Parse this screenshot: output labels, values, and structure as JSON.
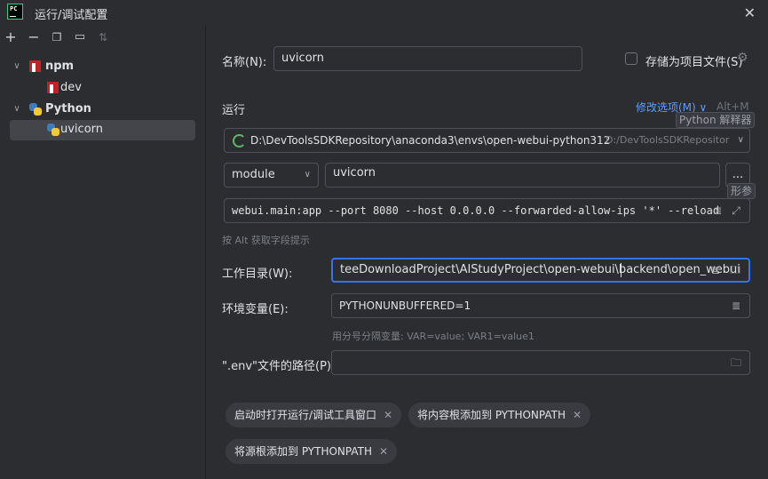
{
  "window": {
    "title": "运行/调试配置",
    "close_icon": "close-icon"
  },
  "toolbar": {
    "icons": [
      "plus-icon",
      "minus-icon",
      "copy-icon",
      "new-folder-icon",
      "sort-icon"
    ]
  },
  "tree": {
    "items": [
      {
        "label": "npm"
      },
      {
        "label": "dev"
      },
      {
        "label": "Python"
      },
      {
        "label": "uvicorn"
      }
    ]
  },
  "form": {
    "name_label": "名称(N):",
    "name_value": "uvicorn",
    "store_label": "存储为项目文件(S)",
    "run_section": "运行",
    "modify_options": "修改选项(M)",
    "modify_shortcut": "Alt+M",
    "interpreter_tooltip": "Python 解释器",
    "interpreter_path": "D:\\DevToolsSDKRepository\\anaconda3\\envs\\open-webui-python312",
    "interpreter_hint": "D:/DevToolsSDKRepositor",
    "module_select": "module",
    "module_value": "uvicorn",
    "browse_button": "...",
    "params_tooltip": "形参",
    "params_value": "webui.main:app --port 8080 --host 0.0.0.0 --forwarded-allow-ips '*' --reload",
    "alt_hint": "按 Alt 获取字段提示",
    "workdir_label": "工作目录(W):",
    "workdir_value": "teeDownloadProject\\AIStudyProject\\open-webui\\backend\\open_webui",
    "env_label": "环境变量(E):",
    "env_value": "PYTHONUNBUFFERED=1",
    "env_hint": "用分号分隔变量: VAR=value; VAR1=value1",
    "dotenv_label": "\".env\"文件的路径(P):",
    "dotenv_value": ""
  },
  "chips": [
    {
      "label": "启动时打开运行/调试工具窗口"
    },
    {
      "label": "将内容根添加到 PYTHONPATH"
    },
    {
      "label": "将源根添加到 PYTHONPATH"
    }
  ],
  "colors": {
    "accent": "#3574f0",
    "background": "#2b2d30",
    "link": "#5e9cff"
  }
}
